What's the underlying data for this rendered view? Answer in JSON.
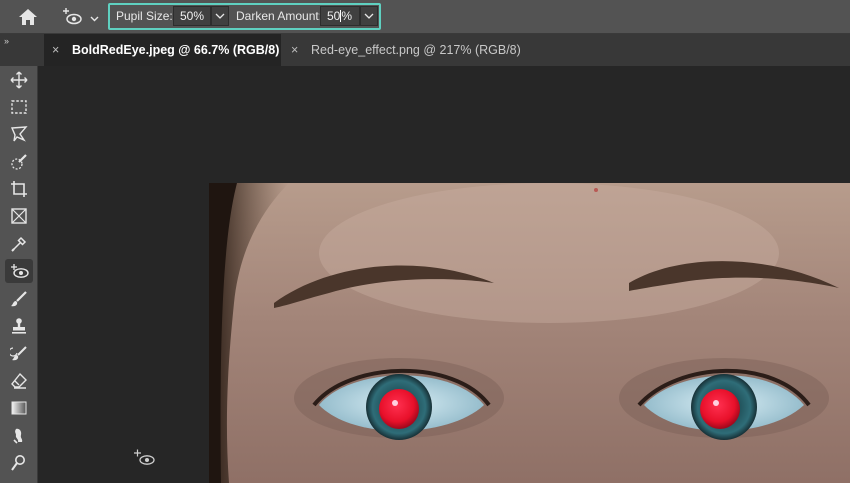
{
  "options_bar": {
    "home_icon": "home-icon",
    "tool_icon": "red-eye-tool-icon",
    "pupil_size": {
      "label": "Pupil Size:",
      "value": "50%"
    },
    "darken_amount": {
      "label": "Darken Amount:",
      "value_before_caret": "50",
      "value_after_caret": "%"
    }
  },
  "tabs": [
    {
      "label": "BoldRedEye.jpeg @ 66.7% (RGB/8)",
      "active": true
    },
    {
      "label": "Red-eye_effect.png @ 217% (RGB/8)",
      "active": false
    }
  ],
  "tab_close_glyph": "×",
  "panel_expander": "››",
  "toolbar": {
    "tools": [
      "move-icon",
      "rectangular-marquee-icon",
      "lasso-icon",
      "quick-selection-icon",
      "crop-icon",
      "frame-icon",
      "eyedropper-icon",
      "red-eye-tool-icon",
      "brush-icon",
      "clone-stamp-icon",
      "history-brush-icon",
      "eraser-icon",
      "gradient-icon",
      "smudge-icon",
      "dodge-icon"
    ],
    "active_tool": "red-eye-tool-icon"
  },
  "colors": {
    "highlight": "#5fd0c0",
    "panel": "#535353",
    "canvas_bg": "#262626",
    "red_pupil": "#e8102a"
  }
}
